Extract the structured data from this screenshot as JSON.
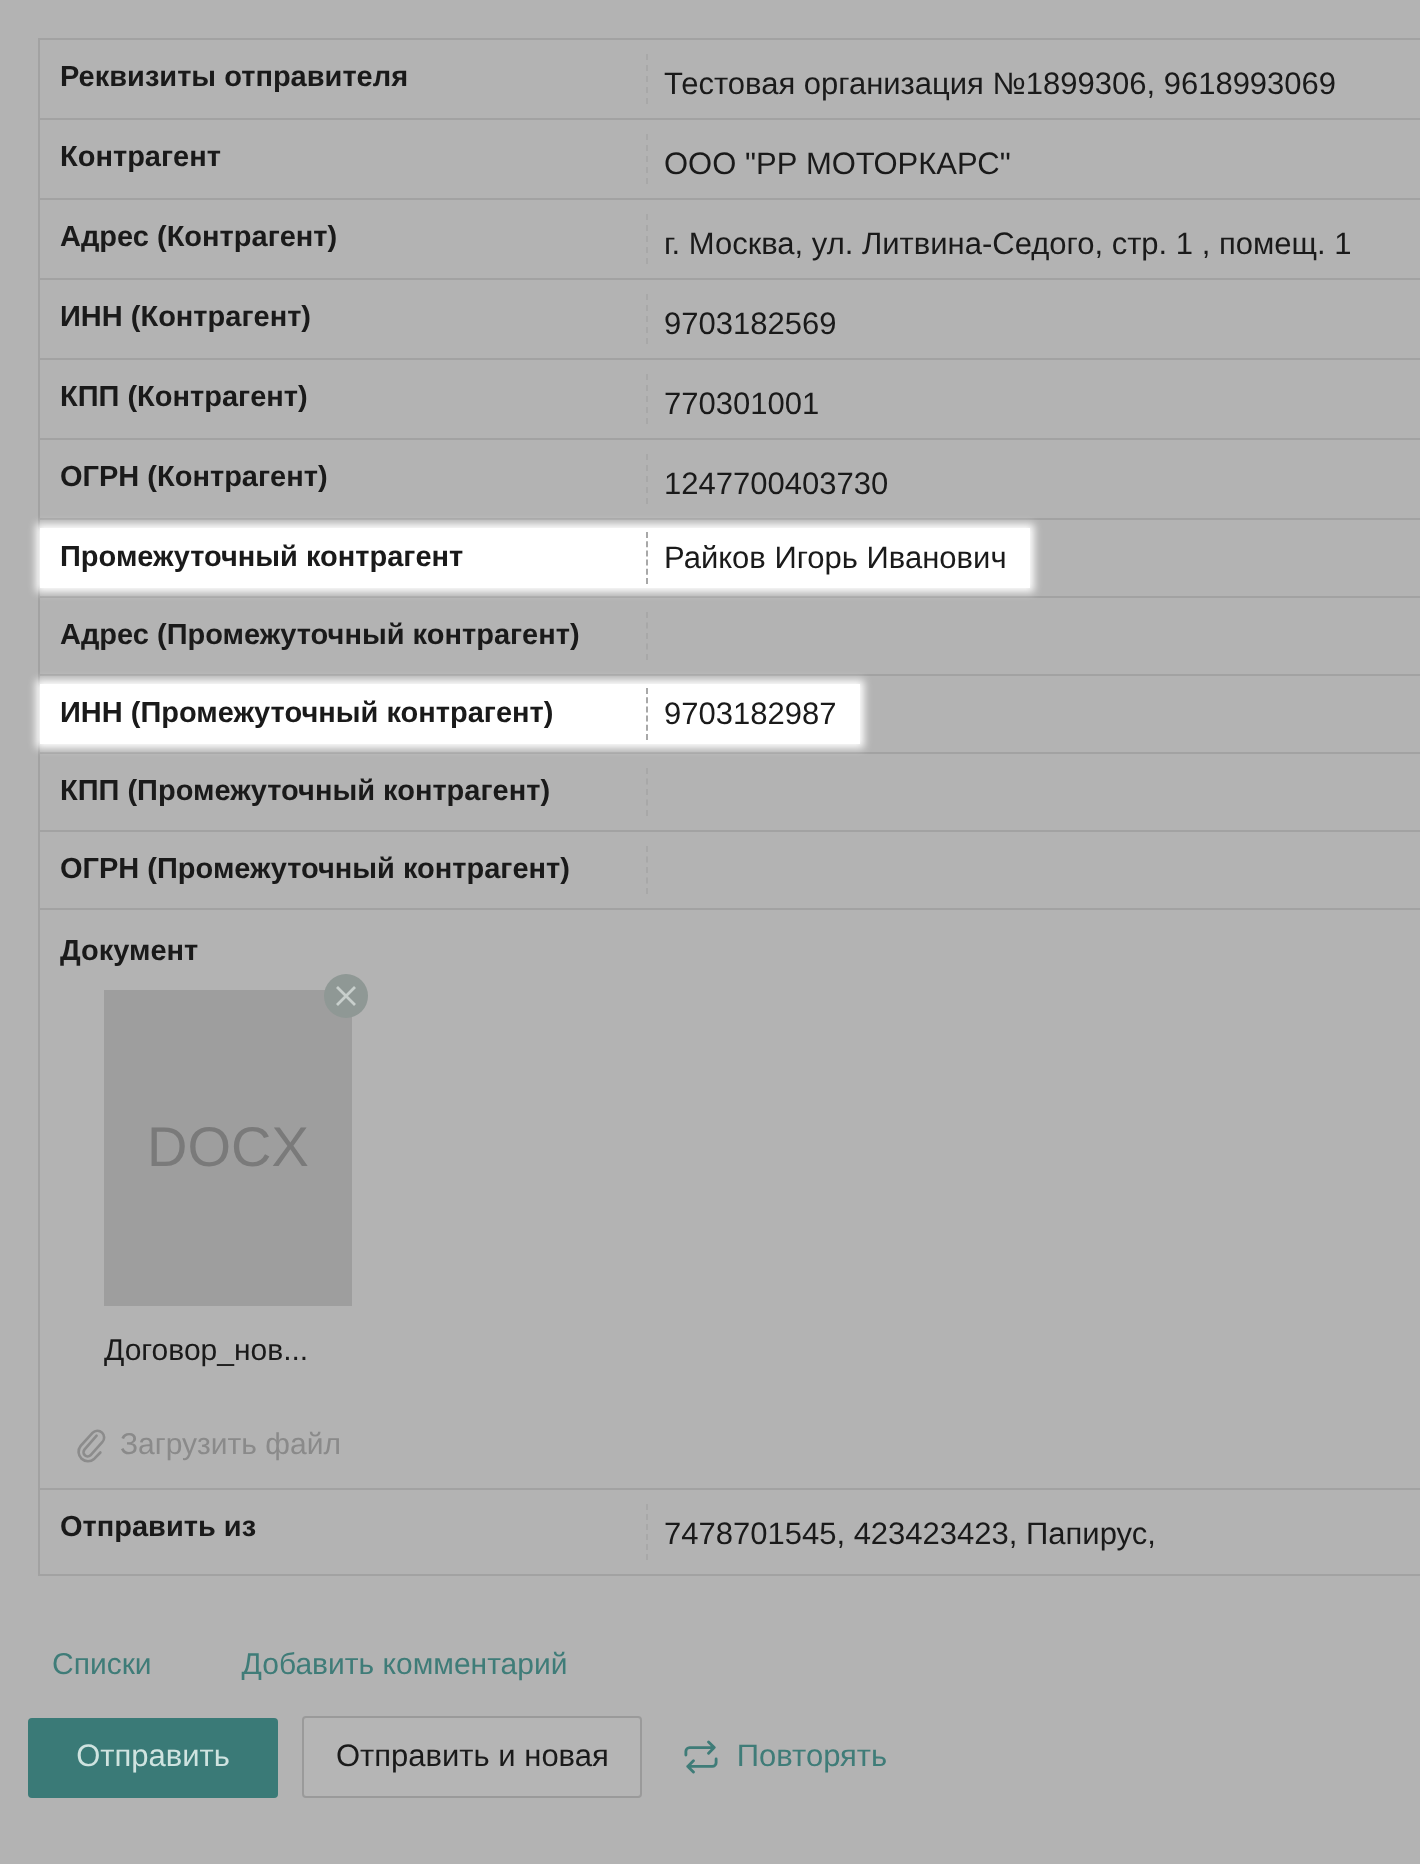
{
  "rows": [
    {
      "kind": "field",
      "label": "Реквизиты отправителя",
      "value": "Тестовая организация №1899306, 9618993069",
      "highlighted": false
    },
    {
      "kind": "field",
      "label": "Контрагент",
      "value": "ООО \"РР МОТОРКАРС\"",
      "highlighted": false
    },
    {
      "kind": "field",
      "label": "Адрес (Контрагент)",
      "value": "г. Москва, ул. Литвина-Седого, стр. 1 , помещ. 1",
      "highlighted": false
    },
    {
      "kind": "field",
      "label": "ИНН (Контрагент)",
      "value": "9703182569",
      "highlighted": false
    },
    {
      "kind": "field",
      "label": "КПП (Контрагент)",
      "value": "770301001",
      "highlighted": false
    },
    {
      "kind": "field",
      "label": "ОГРН (Контрагент)",
      "value": "1247700403730",
      "highlighted": false
    },
    {
      "kind": "field",
      "label": "Промежуточный контрагент",
      "value": "Райков Игорь Иванович",
      "highlighted": true
    },
    {
      "kind": "field",
      "label": "Адрес (Промежуточный контрагент)",
      "highlighted": false
    },
    {
      "kind": "field",
      "label": "ИНН (Промежуточный контрагент)",
      "value": "9703182987",
      "highlighted": true
    },
    {
      "kind": "field",
      "label": "КПП (Промежуточный контрагент)",
      "highlighted": false
    },
    {
      "kind": "field",
      "label": "ОГРН (Промежуточный контрагент)",
      "highlighted": false
    },
    {
      "kind": "document",
      "label": "Документ",
      "file": {
        "type": "DOCX",
        "name": "Договор_нов..."
      },
      "upload": "Загрузить файл"
    },
    {
      "kind": "field",
      "label": "Отправить из",
      "value": "7478701545, 423423423, Папирус,",
      "highlighted": false
    }
  ],
  "links": [
    "Списки",
    "Добавить комментарий"
  ],
  "buttons": {
    "primary": "Отправить",
    "secondary": "Отправить и новая",
    "repeat": "Повторять"
  }
}
